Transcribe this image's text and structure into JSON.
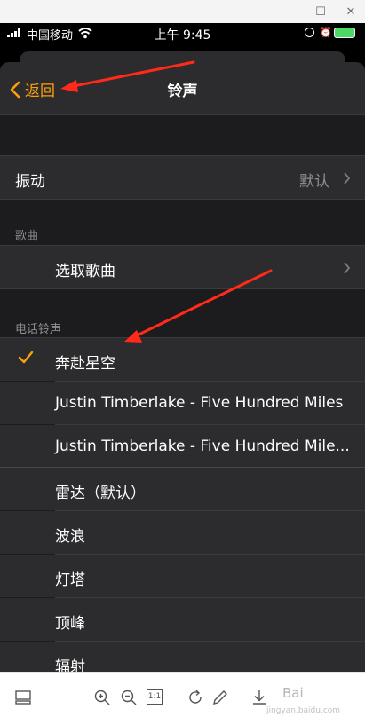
{
  "window": {
    "min_glyph": "—",
    "max_glyph": "☐",
    "close_glyph": "✕"
  },
  "status_bar": {
    "carrier": "中国移动",
    "time": "上午 9:45",
    "alarm_glyph": "⏰"
  },
  "nav": {
    "back_label": "返回",
    "title": "铃声"
  },
  "vibration": {
    "label": "振动",
    "value": "默认"
  },
  "songs_section": {
    "header": "歌曲",
    "pick_label": "选取歌曲"
  },
  "ringtones_section": {
    "header": "电话铃声",
    "selected": "奔赴星空",
    "items": [
      "Justin Timberlake - Five Hundred Miles",
      "Justin Timberlake - Five Hundred Mile..."
    ],
    "builtin": [
      "雷达（默认）",
      "波浪",
      "灯塔",
      "顶峰",
      "辐射"
    ]
  },
  "toolbar": {
    "watermark": "Bai",
    "watermark_sub": "jingyan.baidu.com",
    "icons": [
      "thumbnail-icon",
      "zoom-in-icon",
      "zoom-out-icon",
      "actual-size-icon",
      "rotate-icon",
      "edit-icon",
      "download-icon"
    ],
    "actual_size_label": "1:1"
  },
  "colors": {
    "accent": "#ff9f0a",
    "background": "#1c1c1e",
    "cell": "#2c2c2e",
    "annotation": "#ff2a1a"
  }
}
